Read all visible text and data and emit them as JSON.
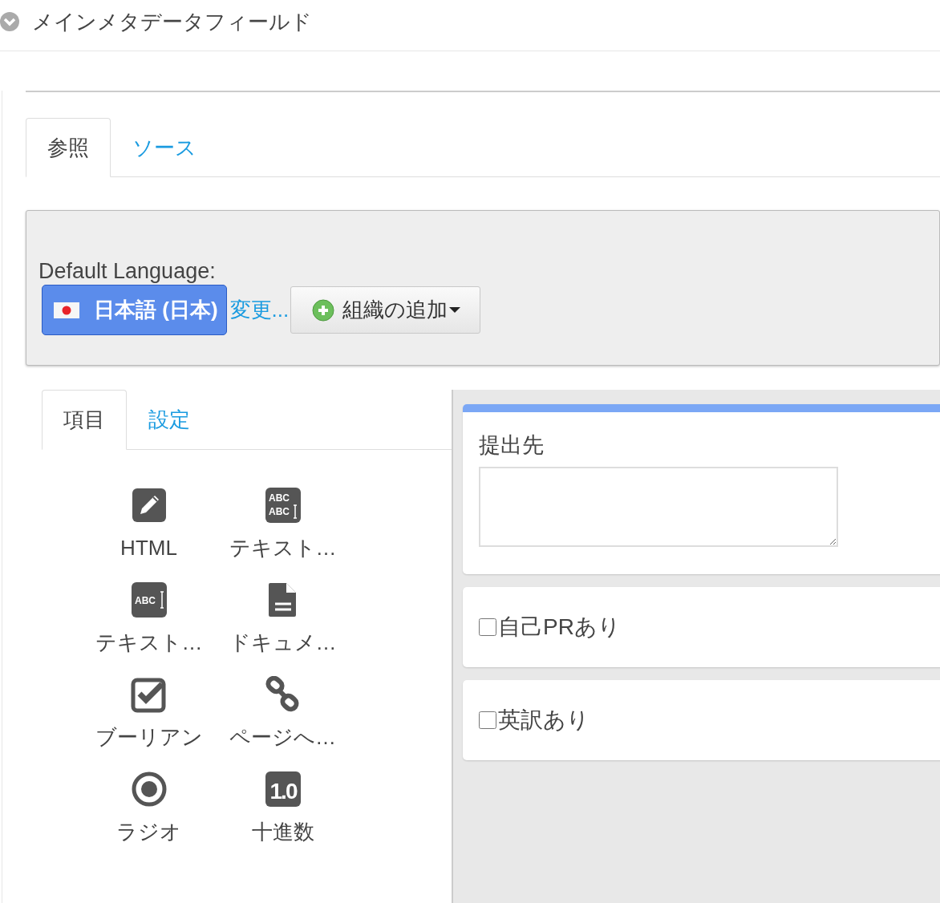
{
  "header": {
    "title": "メインメタデータフィールド"
  },
  "tabs": [
    {
      "label": "参照",
      "selected": true
    },
    {
      "label": "ソース",
      "selected": false
    }
  ],
  "language_panel": {
    "label": "Default Language:",
    "language_button": "日本語 (日本)",
    "change_link": "変更...",
    "add_button": "組織の追加"
  },
  "palette_tabs": [
    {
      "label": "項目",
      "selected": true
    },
    {
      "label": "設定",
      "selected": false
    }
  ],
  "palette_items": [
    {
      "kind": "pencil",
      "label": "HTML"
    },
    {
      "kind": "text-area",
      "label": "テキスト…"
    },
    {
      "kind": "text-line",
      "label": "テキスト…"
    },
    {
      "kind": "document",
      "label": "ドキュメ…"
    },
    {
      "kind": "checkbox",
      "label": "ブーリアン"
    },
    {
      "kind": "link",
      "label": "ページへ…"
    },
    {
      "kind": "radio",
      "label": "ラジオ"
    },
    {
      "kind": "decimal",
      "label": "十進数"
    }
  ],
  "palette_icon_texts": [
    "ABC",
    "ABC",
    "ABC",
    "1.0"
  ],
  "form_fields": [
    {
      "kind": "textarea",
      "label": "提出先",
      "selected": true
    },
    {
      "kind": "checkbox",
      "label": "自己PRあり",
      "checked": false,
      "selected": false
    },
    {
      "kind": "checkbox",
      "label": "英訳あり",
      "checked": false,
      "selected": false
    }
  ]
}
